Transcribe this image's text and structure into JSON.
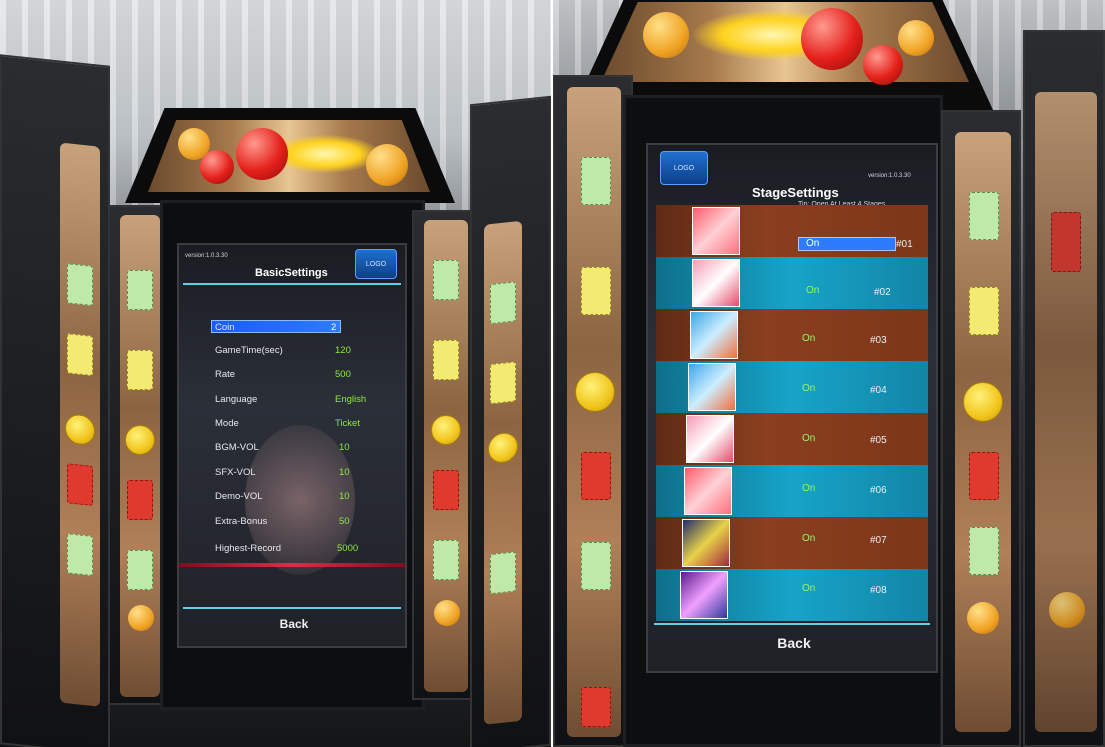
{
  "left_screen": {
    "version": "version:1.0.3.30",
    "title": "BasicSettings",
    "logo_text": "LOGO",
    "settings": [
      {
        "label": "Coin",
        "value": "2",
        "selected": true
      },
      {
        "label": "GameTime(sec)",
        "value": "120"
      },
      {
        "label": "Rate",
        "value": "500"
      },
      {
        "label": "Language",
        "value": "English"
      },
      {
        "label": "Mode",
        "value": "Ticket"
      },
      {
        "label": "BGM-VOL",
        "value": "10"
      },
      {
        "label": "SFX-VOL",
        "value": "10"
      },
      {
        "label": "Demo-VOL",
        "value": "10"
      },
      {
        "label": "Extra-Bonus",
        "value": "50"
      },
      {
        "label": "Highest-Record",
        "value": "5000"
      }
    ],
    "back_label": "Back"
  },
  "right_screen": {
    "version": "version:1.0.3.30",
    "title": "StageSettings",
    "tip": "Tip: Open At Least 4 Stages",
    "logo_text": "LOGO",
    "stages": [
      {
        "num": "#01",
        "status": "On",
        "selected": true
      },
      {
        "num": "#02",
        "status": "On"
      },
      {
        "num": "#03",
        "status": "On"
      },
      {
        "num": "#04",
        "status": "On"
      },
      {
        "num": "#05",
        "status": "On"
      },
      {
        "num": "#06",
        "status": "On"
      },
      {
        "num": "#07",
        "status": "On"
      },
      {
        "num": "#08",
        "status": "On"
      }
    ],
    "back_label": "Back"
  },
  "colors": {
    "value_green": "#8ee84a",
    "select_blue": "#2d7bff",
    "row_brown": "#8a3f1f",
    "row_teal": "#17a4c8",
    "divider_cyan": "#5fd0e8"
  }
}
